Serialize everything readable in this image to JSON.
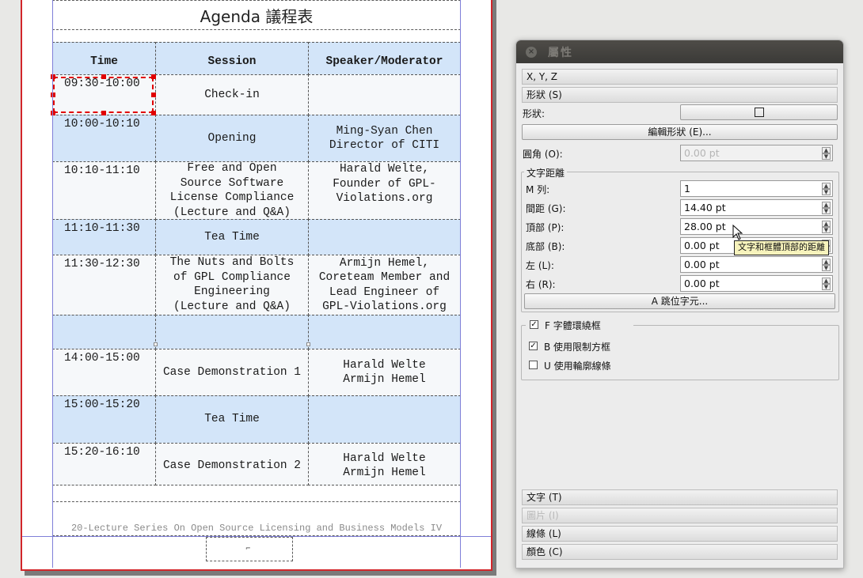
{
  "document": {
    "title": "Agenda 議程表",
    "headers": [
      "Time",
      "Session",
      "Speaker/Moderator"
    ],
    "rows": [
      {
        "time": "09:30-10:00",
        "session": "Check-in",
        "speaker": ""
      },
      {
        "time": "10:00-10:10",
        "session": "Opening",
        "speaker": "Ming-Syan Chen\nDirector of CITI"
      },
      {
        "time": "10:10-11:10",
        "session": "Free and Open\nSource Software\nLicense Compliance\n(Lecture and Q&A)",
        "speaker": "Harald Welte,\nFounder of GPL-\nViolations.org"
      },
      {
        "time": "11:10-11:30",
        "session": "Tea Time",
        "speaker": ""
      },
      {
        "time": "11:30-12:30",
        "session": "The Nuts and Bolts\nof GPL Compliance\nEngineering\n(Lecture and Q&A)",
        "speaker": "Armijn Hemel,\nCoreteam Member and\nLead Engineer of\nGPL-Violations.org"
      },
      {
        "time": "",
        "session": "",
        "speaker": ""
      },
      {
        "time": "14:00-15:00",
        "session": "Case Demonstration 1",
        "speaker": "Harald Welte\nArmijn Hemel"
      },
      {
        "time": "15:00-15:20",
        "session": "Tea Time",
        "speaker": ""
      },
      {
        "time": "15:20-16:10",
        "session": "Case Demonstration 2",
        "speaker": "Harald Welte\nArmijn Hemel"
      }
    ],
    "footer": "20-Lecture Series On Open Source Licensing and Business Models IV"
  },
  "panel": {
    "title": "屬性",
    "sections": {
      "xyz": "X, Y, Z",
      "shape": "形狀 (S)",
      "text": "文字 (T)",
      "image": "圖片 (I)",
      "line": "線條 (L)",
      "color": "顏色 (C)"
    },
    "shape_label": "形狀:",
    "edit_shape_button": "編輯形狀 (E)...",
    "corner_label": "圓角 (O):",
    "corner_value": "0.00 pt",
    "text_distance_group": "文字距離",
    "fields": [
      {
        "label": "M 列:",
        "value": "1"
      },
      {
        "label": "間距 (G):",
        "value": "14.40 pt"
      },
      {
        "label": "頂部 (P):",
        "value": "28.00 pt"
      },
      {
        "label": "底部 (B):",
        "value": "0.00 pt"
      },
      {
        "label": "左 (L):",
        "value": "0.00 pt"
      },
      {
        "label": "右 (R):",
        "value": "0.00 pt"
      }
    ],
    "tabulators_button": "A 跳位字元...",
    "text_flow_group": "F 字體環繞框",
    "use_bounding_box": "B 使用限制方框",
    "use_contour_line": "U 使用輪廓線條",
    "tooltip": "文字和框體頂部的距離"
  },
  "colors": {
    "row_blue": "#d3e5f9",
    "page_border": "#d2262a",
    "selection": "#e00000",
    "tooltip_bg": "#f7f3bc"
  }
}
